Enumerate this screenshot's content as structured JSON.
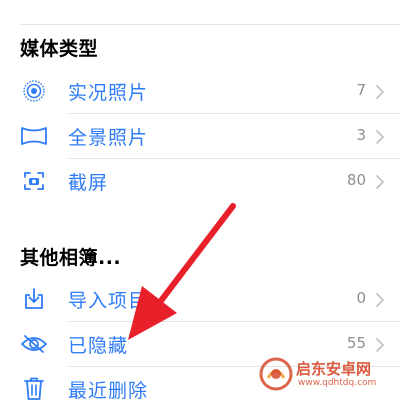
{
  "sections": {
    "media_types": {
      "title": "媒体类型",
      "items": [
        {
          "label": "实况照片",
          "count": "7",
          "icon": "live-photo-icon"
        },
        {
          "label": "全景照片",
          "count": "3",
          "icon": "panorama-icon"
        },
        {
          "label": "截屏",
          "count": "80",
          "icon": "screenshot-icon"
        }
      ]
    },
    "other_albums": {
      "title": "其他相簿...",
      "items": [
        {
          "label": "导入项目",
          "count": "0",
          "icon": "import-icon"
        },
        {
          "label": "已隐藏",
          "count": "55",
          "icon": "hidden-eye-icon"
        },
        {
          "label": "最近删除",
          "count": "",
          "icon": "trash-icon"
        }
      ]
    }
  },
  "colors": {
    "accent": "#2f7cf6",
    "annotation_arrow": "#e8202a",
    "count_gray": "#8e8e93",
    "watermark": "#d64a2b"
  },
  "watermark": {
    "title": "启东安卓网",
    "url": "www.qdhtdq.com"
  }
}
